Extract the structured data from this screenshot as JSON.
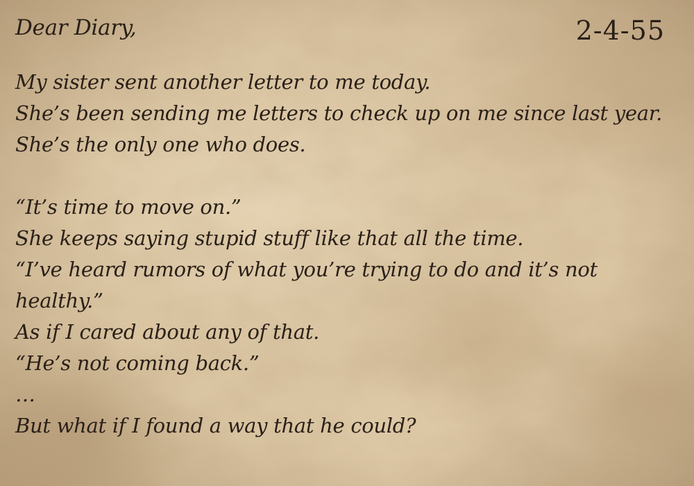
{
  "diary": {
    "greeting": "Dear Diary,",
    "date": "2-4-55",
    "lines": [
      "My sister sent another letter to me today.",
      "She’s been sending me letters to check up on me since last year.",
      "She’s the only one who does.",
      "",
      "“It’s time to move on.”",
      "She keeps saying stupid stuff like that all the time.",
      "“I’ve heard rumors of what you’re trying to do and it’s not",
      "healthy.”",
      "As if I cared about any of that.",
      "“He’s not coming back.”",
      "…",
      "But what if I found a way that he could?"
    ]
  },
  "colors": {
    "paper": "#dcc7a4",
    "ink": "#2a2018"
  }
}
